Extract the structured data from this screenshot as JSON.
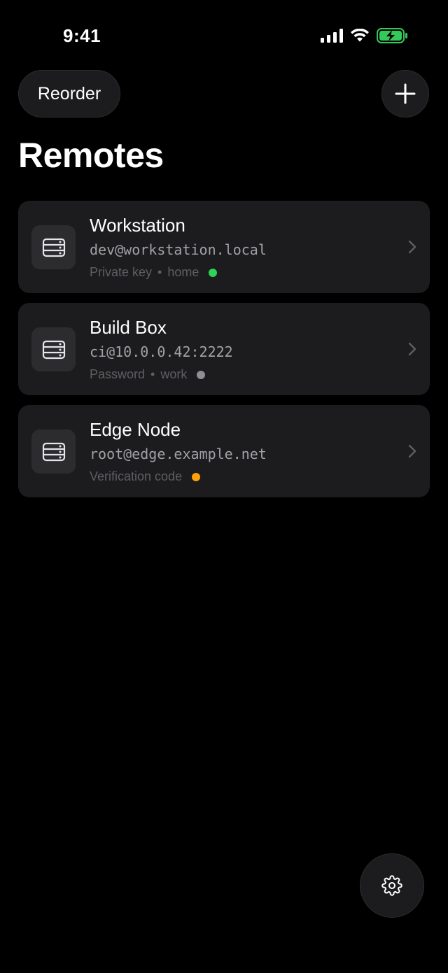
{
  "status_bar": {
    "time": "9:41",
    "icons": [
      "cellular-signal-icon",
      "wifi-icon",
      "battery-charging-icon"
    ],
    "battery_color": "#34c759"
  },
  "header": {
    "reorder_label": "Reorder",
    "add_icon": "plus-icon",
    "title": "Remotes"
  },
  "remotes": [
    {
      "name": "Workstation",
      "address": "dev@workstation.local",
      "auth": "Private key",
      "group": "home",
      "status_color": "#30d158"
    },
    {
      "name": "Build Box",
      "address": "ci@10.0.0.42:2222",
      "auth": "Password",
      "group": "work",
      "status_color": "#8e8e93"
    },
    {
      "name": "Edge Node",
      "address": "root@edge.example.net",
      "auth": "Verification code",
      "group": "",
      "status_color": "#ff9f0a"
    }
  ],
  "footer": {
    "settings_icon": "gear-icon"
  },
  "theme": {
    "background": "#000000",
    "card": "#1c1c1e",
    "tile": "#2c2c2e"
  }
}
